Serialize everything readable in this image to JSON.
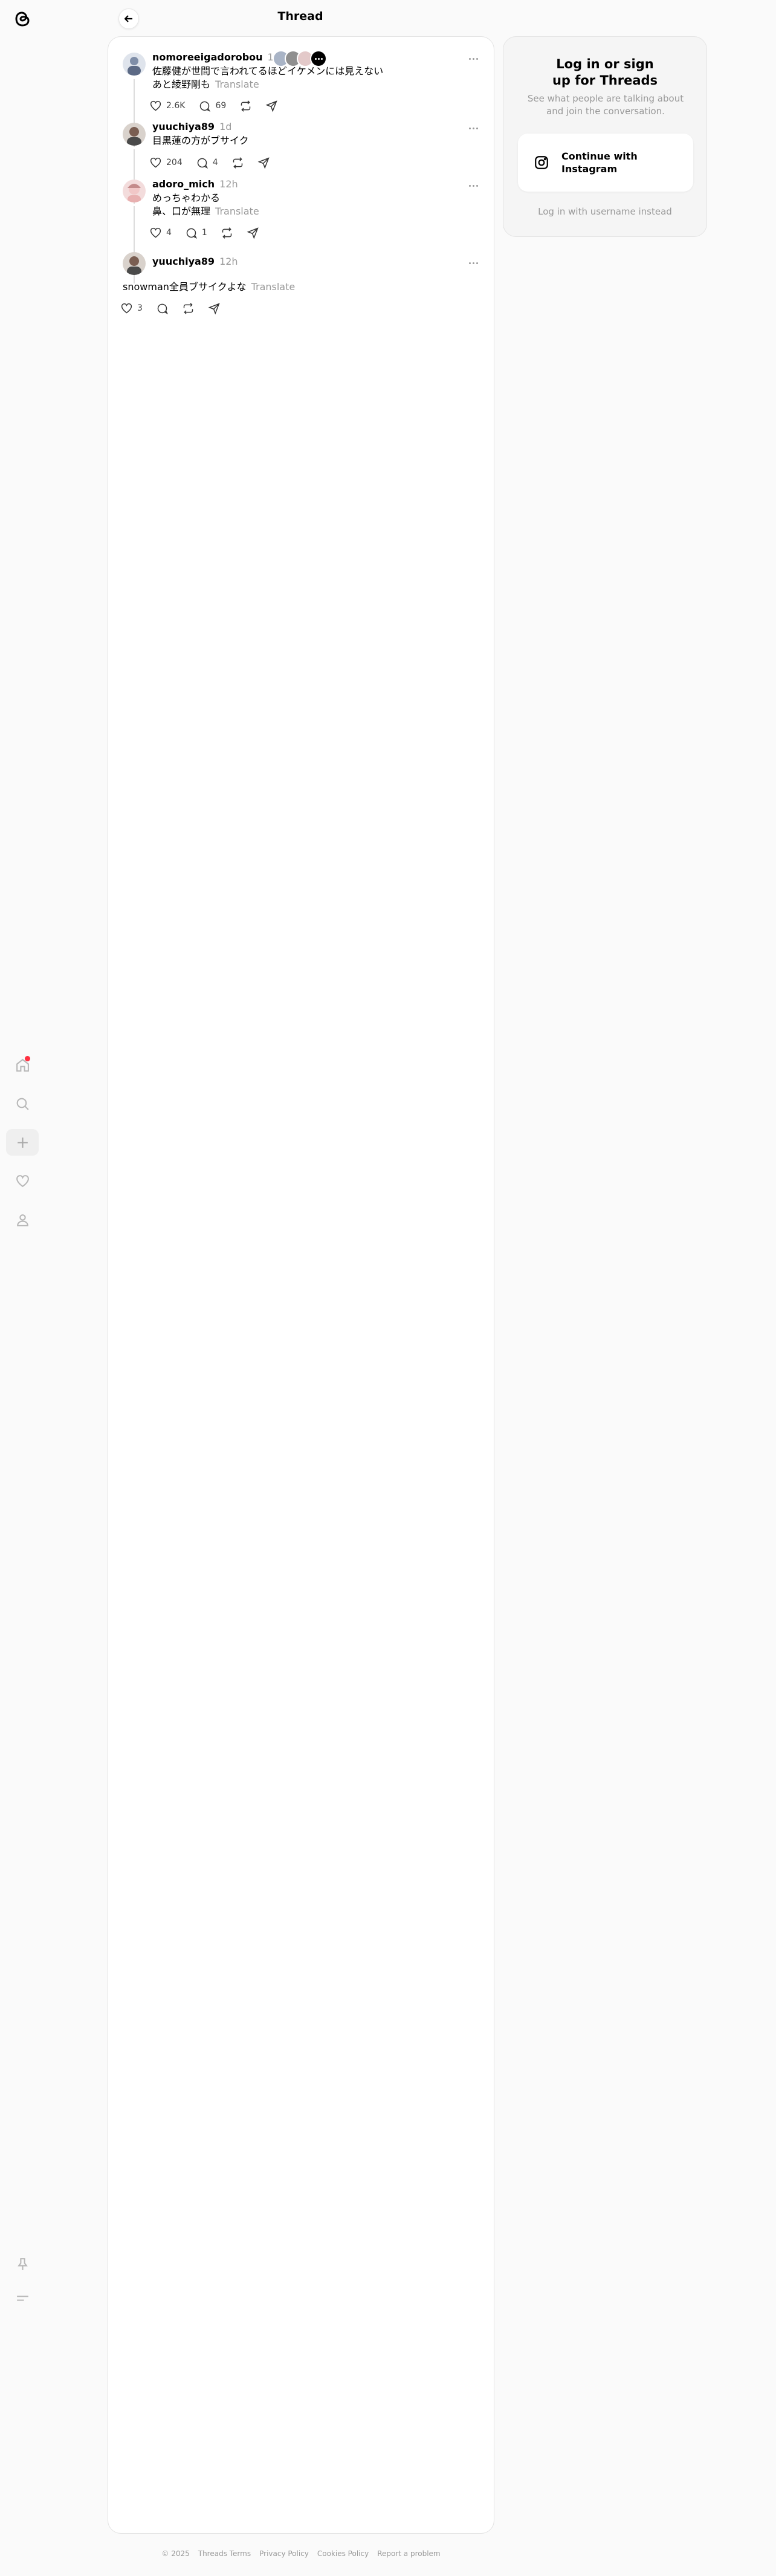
{
  "header": {
    "title": "Thread",
    "back_icon": "arrow-left-icon"
  },
  "nav": {
    "logo_icon": "threads-logo-icon",
    "items": [
      {
        "icon": "home-icon",
        "has_notification": true
      },
      {
        "icon": "search-icon"
      },
      {
        "icon": "plus-icon"
      },
      {
        "icon": "heart-icon"
      },
      {
        "icon": "profile-icon"
      }
    ],
    "bottom_items": [
      {
        "icon": "pin-icon"
      },
      {
        "icon": "menu-icon"
      }
    ]
  },
  "posts": [
    {
      "username": "nomoreeigadorobou",
      "time": "1d",
      "text_lines": [
        "佐藤健が世間で言われてるほどイケメンには見えない",
        "あと綾野剛も"
      ],
      "translate": "Translate",
      "likes": "2.6K",
      "replies": "69"
    },
    {
      "username": "yuuchiya89",
      "time": "1d",
      "text_lines": [
        "目黒蓮の方がブサイク"
      ],
      "likes": "204",
      "replies": "4"
    },
    {
      "username": "adoro_mich",
      "time": "12h",
      "text_lines": [
        "めっちゃわかる",
        "鼻、口が無理"
      ],
      "translate": "Translate",
      "likes": "4",
      "replies": "1"
    },
    {
      "username": "yuuchiya89",
      "time": "12h",
      "text_lines": [
        "snowman全員ブサイクよな"
      ],
      "translate": "Translate",
      "likes": "3"
    }
  ],
  "login": {
    "title": "Log in or sign up for Threads",
    "subtitle": "See what people are talking about and join the conversation.",
    "instagram_button": "Continue with Instagram",
    "username_link": "Log in with username instead"
  },
  "footer": {
    "links": [
      "© 2025",
      "Threads Terms",
      "Privacy Policy",
      "Cookies Policy",
      "Report a problem"
    ]
  },
  "colors": {
    "accent": "#000000",
    "muted": "#999999",
    "notification": "#ff3040",
    "background": "#fafafa"
  }
}
